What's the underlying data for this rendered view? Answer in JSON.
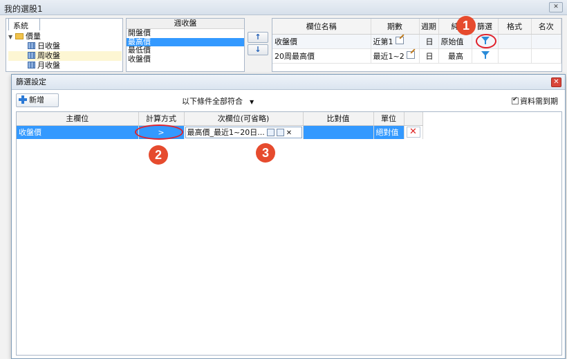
{
  "window": {
    "title": "我的選股1",
    "close_label": "✕"
  },
  "left_panel": {
    "tab": "系統",
    "tree": [
      {
        "label": "價量",
        "type": "folder"
      },
      {
        "label": "日收盤",
        "type": "grid"
      },
      {
        "label": "周收盤",
        "type": "grid"
      },
      {
        "label": "月收盤",
        "type": "grid"
      }
    ]
  },
  "field_list": {
    "header": "週收盤",
    "items": [
      "開盤價",
      "最高價",
      "最低價",
      "收盤價"
    ],
    "selected_index": 1
  },
  "move_buttons": {
    "up": "↑",
    "down": "↓"
  },
  "column_grid": {
    "headers": [
      "欄位名稱",
      "期數",
      "週期",
      "純",
      "篩選",
      "格式",
      "名次"
    ],
    "rows": [
      {
        "name": "收盤價",
        "period": "近第1",
        "cycle": "日",
        "value": "原始值"
      },
      {
        "name": "20周最高價",
        "period": "最近1~2",
        "cycle": "日",
        "value": "最高"
      }
    ]
  },
  "callouts": [
    "1",
    "2",
    "3"
  ],
  "filter_dialog": {
    "title": "篩選設定",
    "close_label": "✕",
    "add_label": "新增",
    "condition": "以下條件全部符合",
    "checkbox_label": "資料需到期",
    "checkbox_checked": true,
    "headers": [
      "主欄位",
      "計算方式",
      "次欄位(可省略)",
      "比對值",
      "單位"
    ],
    "row": {
      "main": "收盤價",
      "operator": ">",
      "secondary": "最高價_最近1~20日...",
      "compare": "",
      "unit": "絕對值",
      "delete": "✕"
    }
  },
  "colors": {
    "selection": "#3399ff",
    "callout": "#e64b2e",
    "ring": "#e0202a"
  }
}
